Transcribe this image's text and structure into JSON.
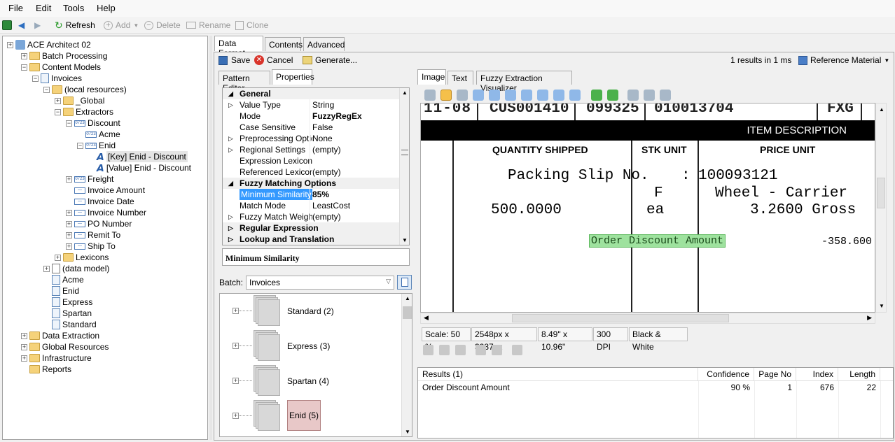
{
  "menu": [
    "File",
    "Edit",
    "Tools",
    "Help"
  ],
  "toolbar": {
    "refresh": "Refresh",
    "add": "Add",
    "delete": "Delete",
    "rename": "Rename",
    "clone": "Clone"
  },
  "tree": {
    "root": "ACE Architect 02",
    "batch": "Batch Processing",
    "content_models": "Content Models",
    "invoices": "Invoices",
    "local": "(local resources)",
    "global": "_Global",
    "extractors": "Extractors",
    "discount": "Discount",
    "acme": "Acme",
    "enid": "Enid",
    "key": "[Key] Enid - Discount",
    "value": "[Value] Enid - Discount",
    "freight": "Freight",
    "inv_amount": "Invoice Amount",
    "inv_date": "Invoice Date",
    "inv_number": "Invoice Number",
    "po": "PO Number",
    "remit": "Remit To",
    "ship": "Ship To",
    "lexicons": "Lexicons",
    "data_model": "(data model)",
    "m_acme": "Acme",
    "m_enid": "Enid",
    "m_express": "Express",
    "m_spartan": "Spartan",
    "m_standard": "Standard",
    "data_extraction": "Data Extraction",
    "global_resources": "Global Resources",
    "infrastructure": "Infrastructure",
    "reports": "Reports"
  },
  "tabs": {
    "data_format": "Data Format",
    "contents": "Contents",
    "advanced": "Advanced",
    "pattern_editor": "Pattern Editor",
    "properties": "Properties",
    "image": "Image",
    "text": "Text",
    "fuzzy": "Fuzzy Extraction Visualizer"
  },
  "actions": {
    "save": "Save",
    "cancel": "Cancel",
    "generate": "Generate...",
    "results_info": "1 results in 1 ms",
    "reference": "Reference Material"
  },
  "props": {
    "general": "General",
    "value_type_k": "Value Type",
    "value_type_v": "String",
    "mode_k": "Mode",
    "mode_v": "FuzzyRegEx",
    "case_k": "Case Sensitive",
    "case_v": "False",
    "pre_k": "Preprocessing Option",
    "pre_v": "None",
    "reg_k": "Regional Settings",
    "reg_v": "(empty)",
    "expr_k": "Expression Lexicon",
    "ref_k": "Referenced Lexicons",
    "ref_v": "(empty)",
    "fuzzy_opts": "Fuzzy Matching Options",
    "min_k": "Minimum Similarity",
    "min_v": "85%",
    "match_k": "Match Mode",
    "match_v": "LeastCost",
    "weight_k": "Fuzzy Match Weighting",
    "weight_v": "(empty)",
    "regex": "Regular Expression",
    "lookup": "Lookup and Translation",
    "desc": "Minimum Similarity"
  },
  "batch": {
    "label": "Batch:",
    "selected": "Invoices",
    "items": [
      "Standard (2)",
      "Express (3)",
      "Spartan (4)",
      "Enid (5)"
    ]
  },
  "doc": {
    "top_a": "11-08",
    "top_b": "CUS001410",
    "top_c": "099325",
    "top_d": "010013704",
    "top_e": "FXG",
    "item_desc": "ITEM DESCRIPTION",
    "qty": "QUANTITY SHIPPED",
    "stk": "STK UNIT",
    "price": "PRICE UNIT",
    "packing": "Packing Slip No.",
    "colon": ":",
    "packno": "100093121",
    "f": "F",
    "wheel": "Wheel - Carrier",
    "qtyv": "500.0000",
    "ea": "ea",
    "priceval": "3.2600 Gross",
    "highlight": "Order Discount Amount",
    "amount": "-358.600"
  },
  "status": [
    "Scale: 50 %",
    "2548px x 3287px",
    "8.49\" x 10.96\"",
    "300 DPI",
    "Black & White"
  ],
  "results": {
    "headers": [
      "Results (1)",
      "Confidence",
      "Page No",
      "Index",
      "Length"
    ],
    "row": [
      "Order Discount Amount",
      "90 %",
      "1",
      "676",
      "22"
    ]
  }
}
